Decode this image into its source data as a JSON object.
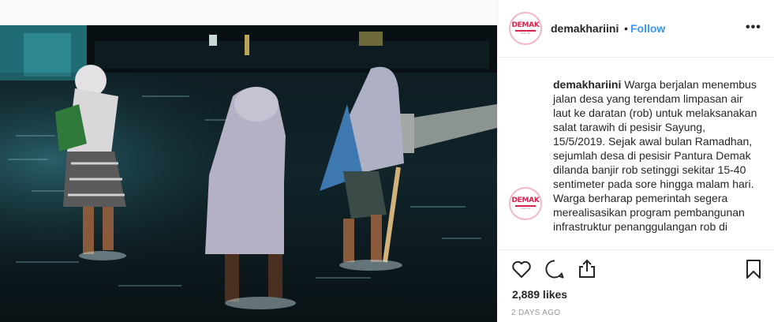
{
  "post": {
    "username": "demakhariini",
    "separator": "•",
    "follow_label": "Follow",
    "more_label": "•••",
    "avatar": {
      "logo_text": "DEMAK",
      "logo_sub": "HARI INI",
      "brand_color": "#d6244f"
    },
    "caption": {
      "username": "demakhariini",
      "text": "Warga berjalan menembus jalan desa yang terendam limpasan air laut ke daratan (rob) untuk melaksanakan salat tarawih di pesisir Sayung, 15/5/2019. Sejak awal bulan Ramadhan, sejumlah desa di pesisir Pantura Demak dilanda banjir rob setinggi sekitar 15-40 sentimeter pada sore hingga malam hari. Warga berharap pemerintah segera merealisasikan program pembangunan infrastruktur penanggulangan rob di"
    },
    "actions": {
      "like_icon": "heart-icon",
      "comment_icon": "comment-icon",
      "share_icon": "share-icon",
      "save_icon": "bookmark-icon"
    },
    "likes_text": "2,889 likes",
    "time_text": "2 DAYS AGO",
    "link_color": "#3897f0"
  }
}
